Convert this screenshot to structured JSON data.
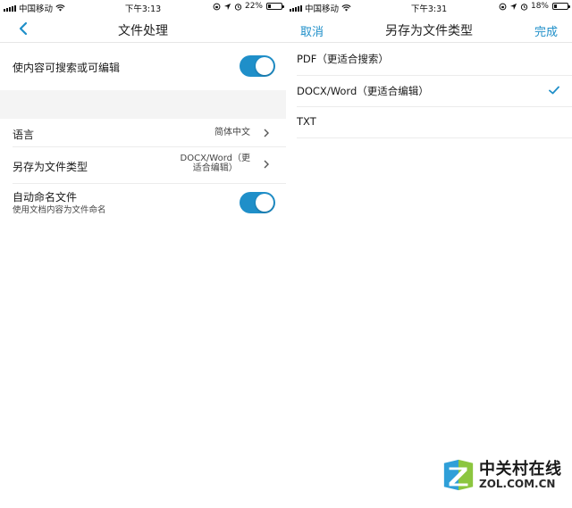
{
  "left": {
    "status": {
      "carrier": "中国移动",
      "time": "下午3:13",
      "battery": "22%",
      "battery_level": 0.22
    },
    "nav": {
      "title": "文件处理"
    },
    "rows": {
      "searchable": {
        "label": "使内容可搜索或可编辑",
        "enabled": true
      },
      "language": {
        "label": "语言",
        "value": "简体中文"
      },
      "save_as": {
        "label": "另存为文件类型",
        "value_line1": "DOCX/Word（更",
        "value_line2": "适合编辑）"
      },
      "auto_name": {
        "label": "自动命名文件",
        "sublabel": "使用文档内容为文件命名",
        "enabled": true
      }
    }
  },
  "right": {
    "status": {
      "carrier": "中国移动",
      "time": "下午3:31",
      "battery": "18%",
      "battery_level": 0.18
    },
    "nav": {
      "cancel": "取消",
      "title": "另存为文件类型",
      "done": "完成"
    },
    "options": [
      {
        "label": "PDF（更适合搜索）",
        "selected": false
      },
      {
        "label": "DOCX/Word（更适合编辑）",
        "selected": true
      },
      {
        "label": "TXT",
        "selected": false
      }
    ]
  },
  "watermark": {
    "brand": "中关村在线",
    "domain": "ZOL.COM.CN"
  },
  "colors": {
    "accent": "#1f8fc9",
    "band": "#f4f4f4",
    "separator": "#ececec"
  },
  "icons": [
    "signal-icon",
    "wifi-icon",
    "lock-rotation-icon",
    "location-icon",
    "alarm-icon",
    "battery-icon",
    "back-chevron-icon",
    "chevron-right-icon",
    "checkmark-icon",
    "zol-logo-icon"
  ]
}
